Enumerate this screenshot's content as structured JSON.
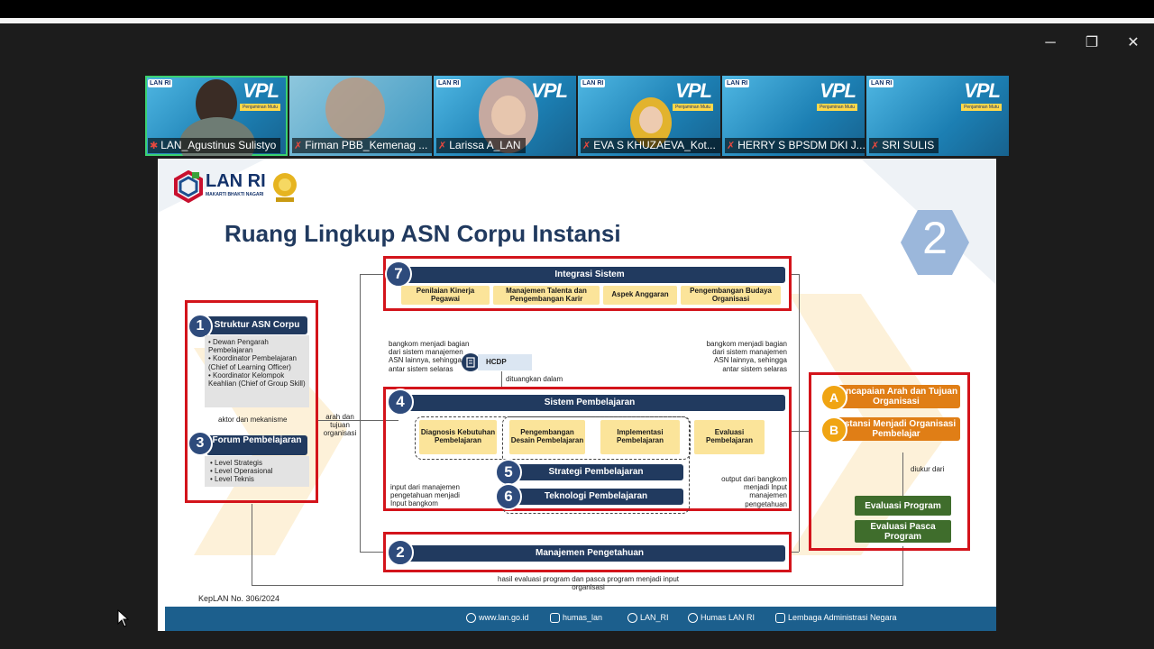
{
  "window": {
    "minimize": "─",
    "restore": "❐",
    "close": "✕"
  },
  "participants": [
    {
      "name": "LAN_Agustinus Sulistyo",
      "active": true
    },
    {
      "name": "Firman PBB_Kemenag ..."
    },
    {
      "name": "Larissa A_LAN"
    },
    {
      "name": "EVA S KHUZAEVA_Kot..."
    },
    {
      "name": "HERRY S BPSDM DKI J..."
    },
    {
      "name": "SRI SULIS"
    }
  ],
  "tile_brand": {
    "logo": "LAN RI",
    "vpl": "VPL",
    "vpl_sub": "Penjaminan Mutu"
  },
  "slide": {
    "logo_text": "LAN RI",
    "logo_sub": "MAKARTI BHAKTI NAGARI",
    "title": "Ruang Lingkup ASN Corpu Instansi",
    "big_number": "2",
    "n1": "1",
    "n2": "2",
    "n3": "3",
    "n4": "4",
    "n5": "5",
    "n6": "6",
    "n7": "7",
    "struktur": "Struktur ASN Corpu",
    "struktur_items": [
      "Dewan Pengarah Pembelajaran",
      "Koordinator Pembelajaran (Chief of Learning Officer)",
      "Koordinator Kelompok Keahlian (Chief of Group Skill)"
    ],
    "aktor": "aktor dan mekanisme",
    "forum": "Forum Pembelajaran",
    "forum_items": [
      "Level Strategis",
      "Level Operasional",
      "Level Teknis"
    ],
    "arah": "arah dan tujuan organisasi",
    "integrasi": "Integrasi Sistem",
    "integrasi_items": [
      "Penilaian Kinerja Pegawai",
      "Manajemen Talenta dan Pengembangan Karir",
      "Aspek Anggaran",
      "Pengembangan Budaya Organisasi"
    ],
    "bangkom_left": "bangkom menjadi bagian dari sistem manajemen ASN lainnya, sehingga antar sistem selaras",
    "bangkom_right": "bangkom menjadi bagian dari sistem manajemen ASN lainnya, sehingga antar sistem selaras",
    "hcdp": "HCDP",
    "dituangkan": "dituangkan dalam",
    "sistem": "Sistem Pembelajaran",
    "sistem_steps": [
      "Diagnosis Kebutuhan Pembelajaran",
      "Pengembangan Desain Pembelajaran",
      "Implementasi Pembelajaran",
      "Evaluasi Pembelajaran"
    ],
    "strategi": "Strategi Pembelajaran",
    "teknologi": "Teknologi Pembelajaran",
    "input_text": "input dari manajemen pengetahuan menjadi Input bangkom",
    "output_text": "output dari bangkom menjadi Input manajemen pengetahuan",
    "manajemen": "Manajemen Pengetahuan",
    "hasil": "hasil evaluasi program dan pasca program menjadi input organisasi",
    "a": "A",
    "b": "B",
    "pencapaian": "Pencapaian Arah dan Tujuan Organisasi",
    "instansi": "Instansi Menjadi Organisasi Pembelajar",
    "diukur": "diukur dari",
    "eval_program": "Evaluasi Program",
    "eval_pasca": "Evaluasi Pasca Program",
    "kep": "KepLAN No. 306/2024",
    "footer": {
      "web": "www.lan.go.id",
      "ig": "humas_lan",
      "tw": "LAN_RI",
      "fb": "Humas LAN RI",
      "yt": "Lembaga Administrasi Negara"
    }
  },
  "colors": {
    "navy": "#213a5f",
    "red": "#d3141b",
    "orange": "#e07e16",
    "green": "#3f6d2c",
    "yellow": "#fbe49a",
    "footer": "#1c5f8d"
  }
}
